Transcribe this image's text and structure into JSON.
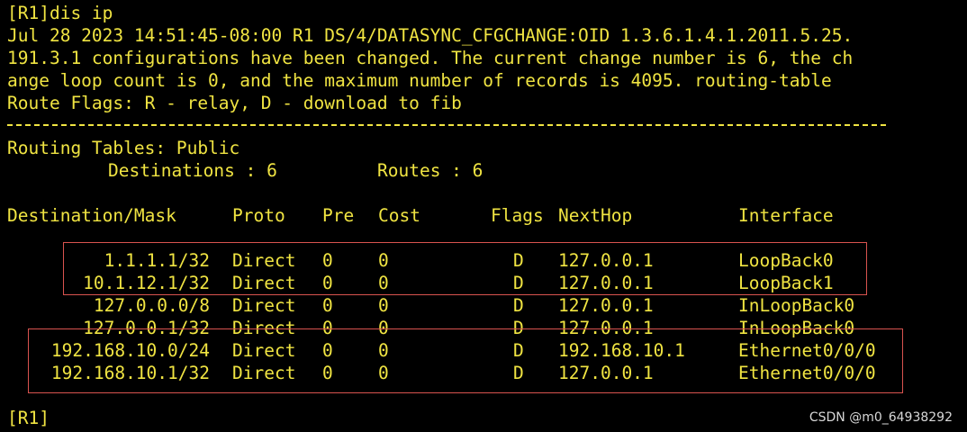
{
  "terminal": {
    "prompt_command": "[R1]dis ip",
    "log_lines": [
      "Jul 28 2023 14:51:45-08:00 R1 DS/4/DATASYNC_CFGCHANGE:OID 1.3.6.1.4.1.2011.5.25.",
      "191.3.1 configurations have been changed. The current change number is 6, the ch",
      "ange loop count is 0, and the maximum number of records is 4095. routing-table"
    ],
    "route_flags": "Route Flags: R - relay, D - download to fib",
    "routing_tables": "Routing Tables: Public",
    "destinations_label": "Destinations : 6",
    "routes_label": "Routes : 6",
    "final_prompt": "[R1]"
  },
  "table": {
    "headers": {
      "destination": "Destination/Mask",
      "proto": "Proto",
      "pre": "Pre",
      "cost": "Cost",
      "flags": "Flags",
      "nexthop": "NextHop",
      "interface": "Interface"
    },
    "rows": [
      {
        "destination": "1.1.1.1/32",
        "proto": "Direct",
        "pre": "0",
        "cost": "0",
        "flags": "D",
        "nexthop": "127.0.0.1",
        "interface": "LoopBack0"
      },
      {
        "destination": "10.1.12.1/32",
        "proto": "Direct",
        "pre": "0",
        "cost": "0",
        "flags": "D",
        "nexthop": "127.0.0.1",
        "interface": "LoopBack1"
      },
      {
        "destination": "127.0.0.0/8",
        "proto": "Direct",
        "pre": "0",
        "cost": "0",
        "flags": "D",
        "nexthop": "127.0.0.1",
        "interface": "InLoopBack0"
      },
      {
        "destination": "127.0.0.1/32",
        "proto": "Direct",
        "pre": "0",
        "cost": "0",
        "flags": "D",
        "nexthop": "127.0.0.1",
        "interface": "InLoopBack0"
      },
      {
        "destination": "192.168.10.0/24",
        "proto": "Direct",
        "pre": "0",
        "cost": "0",
        "flags": "D",
        "nexthop": "192.168.10.1",
        "interface": "Ethernet0/0/0"
      },
      {
        "destination": "192.168.10.1/32",
        "proto": "Direct",
        "pre": "0",
        "cost": "0",
        "flags": "D",
        "nexthop": "127.0.0.1",
        "interface": "Ethernet0/0/0"
      }
    ]
  },
  "watermark": "CSDN @m0_64938292",
  "colors": {
    "background": "#000000",
    "text": "#f0e442",
    "highlight_border": "#d9534f",
    "watermark": "#d8d8d8"
  }
}
